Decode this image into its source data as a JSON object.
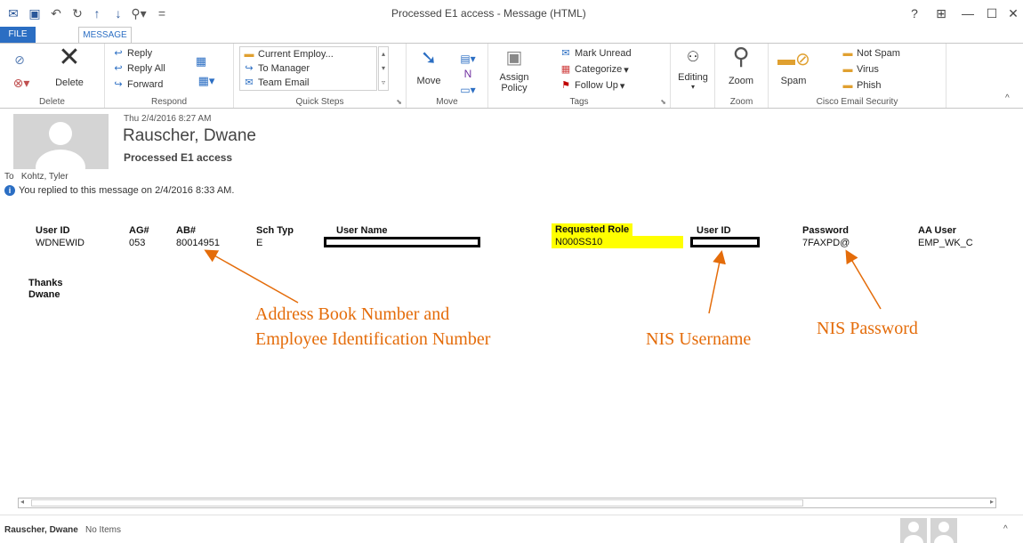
{
  "window": {
    "title": "Processed E1 access  -  Message (HTML)",
    "help": "?",
    "restore": "⊞",
    "minimize": "—",
    "maximize": "☐",
    "close": "✕"
  },
  "tabs": {
    "file": "FILE",
    "message": "MESSAGE"
  },
  "ribbon": {
    "delete": {
      "label": "Delete",
      "group": "Delete"
    },
    "respond": {
      "reply": "Reply",
      "reply_all": "Reply All",
      "forward": "Forward",
      "group": "Respond"
    },
    "quick_steps": {
      "items": [
        "Current Employ...",
        "To Manager",
        "Team Email"
      ],
      "group": "Quick Steps"
    },
    "move": {
      "label": "Move",
      "group": "Move"
    },
    "tags": {
      "assign_policy": "Assign Policy",
      "mark_unread": "Mark Unread",
      "categorize": "Categorize",
      "follow_up": "Follow Up",
      "group": "Tags"
    },
    "editing": {
      "label": "Editing"
    },
    "zoom": {
      "label": "Zoom",
      "group": "Zoom"
    },
    "cisco": {
      "spam": "Spam",
      "not_spam": "Not Spam",
      "virus": "Virus",
      "phish": "Phish",
      "group": "Cisco Email Security"
    }
  },
  "header": {
    "date": "Thu 2/4/2016 8:27 AM",
    "from": "Rauscher, Dwane",
    "subject": "Processed E1 access",
    "to_label": "To",
    "to_name": "Kohtz, Tyler",
    "info": "You replied to this message on 2/4/2016 8:33 AM."
  },
  "table": {
    "headers": [
      "User ID",
      "AG#",
      "AB#",
      "Sch Typ",
      "User Name",
      "Requested Role",
      "User ID",
      "Password",
      "AA User"
    ],
    "row": [
      "WDNEWID",
      "053",
      "80014951",
      "E",
      "",
      "N000SS10",
      "",
      "7FAXPD@",
      "EMP_WK_C"
    ]
  },
  "signature": {
    "line1": "Thanks",
    "line2": "Dwane"
  },
  "annotations": {
    "ab_line1": "Address Book Number and",
    "ab_line2": "Employee Identification Number",
    "nis_user": "NIS Username",
    "nis_pass": "NIS Password",
    "color": "#e46c0a"
  },
  "status": {
    "name": "Rauscher, Dwane",
    "items": "No Items"
  },
  "colors": {
    "accent": "#2b6ec3",
    "highlight": "#ffff00"
  }
}
